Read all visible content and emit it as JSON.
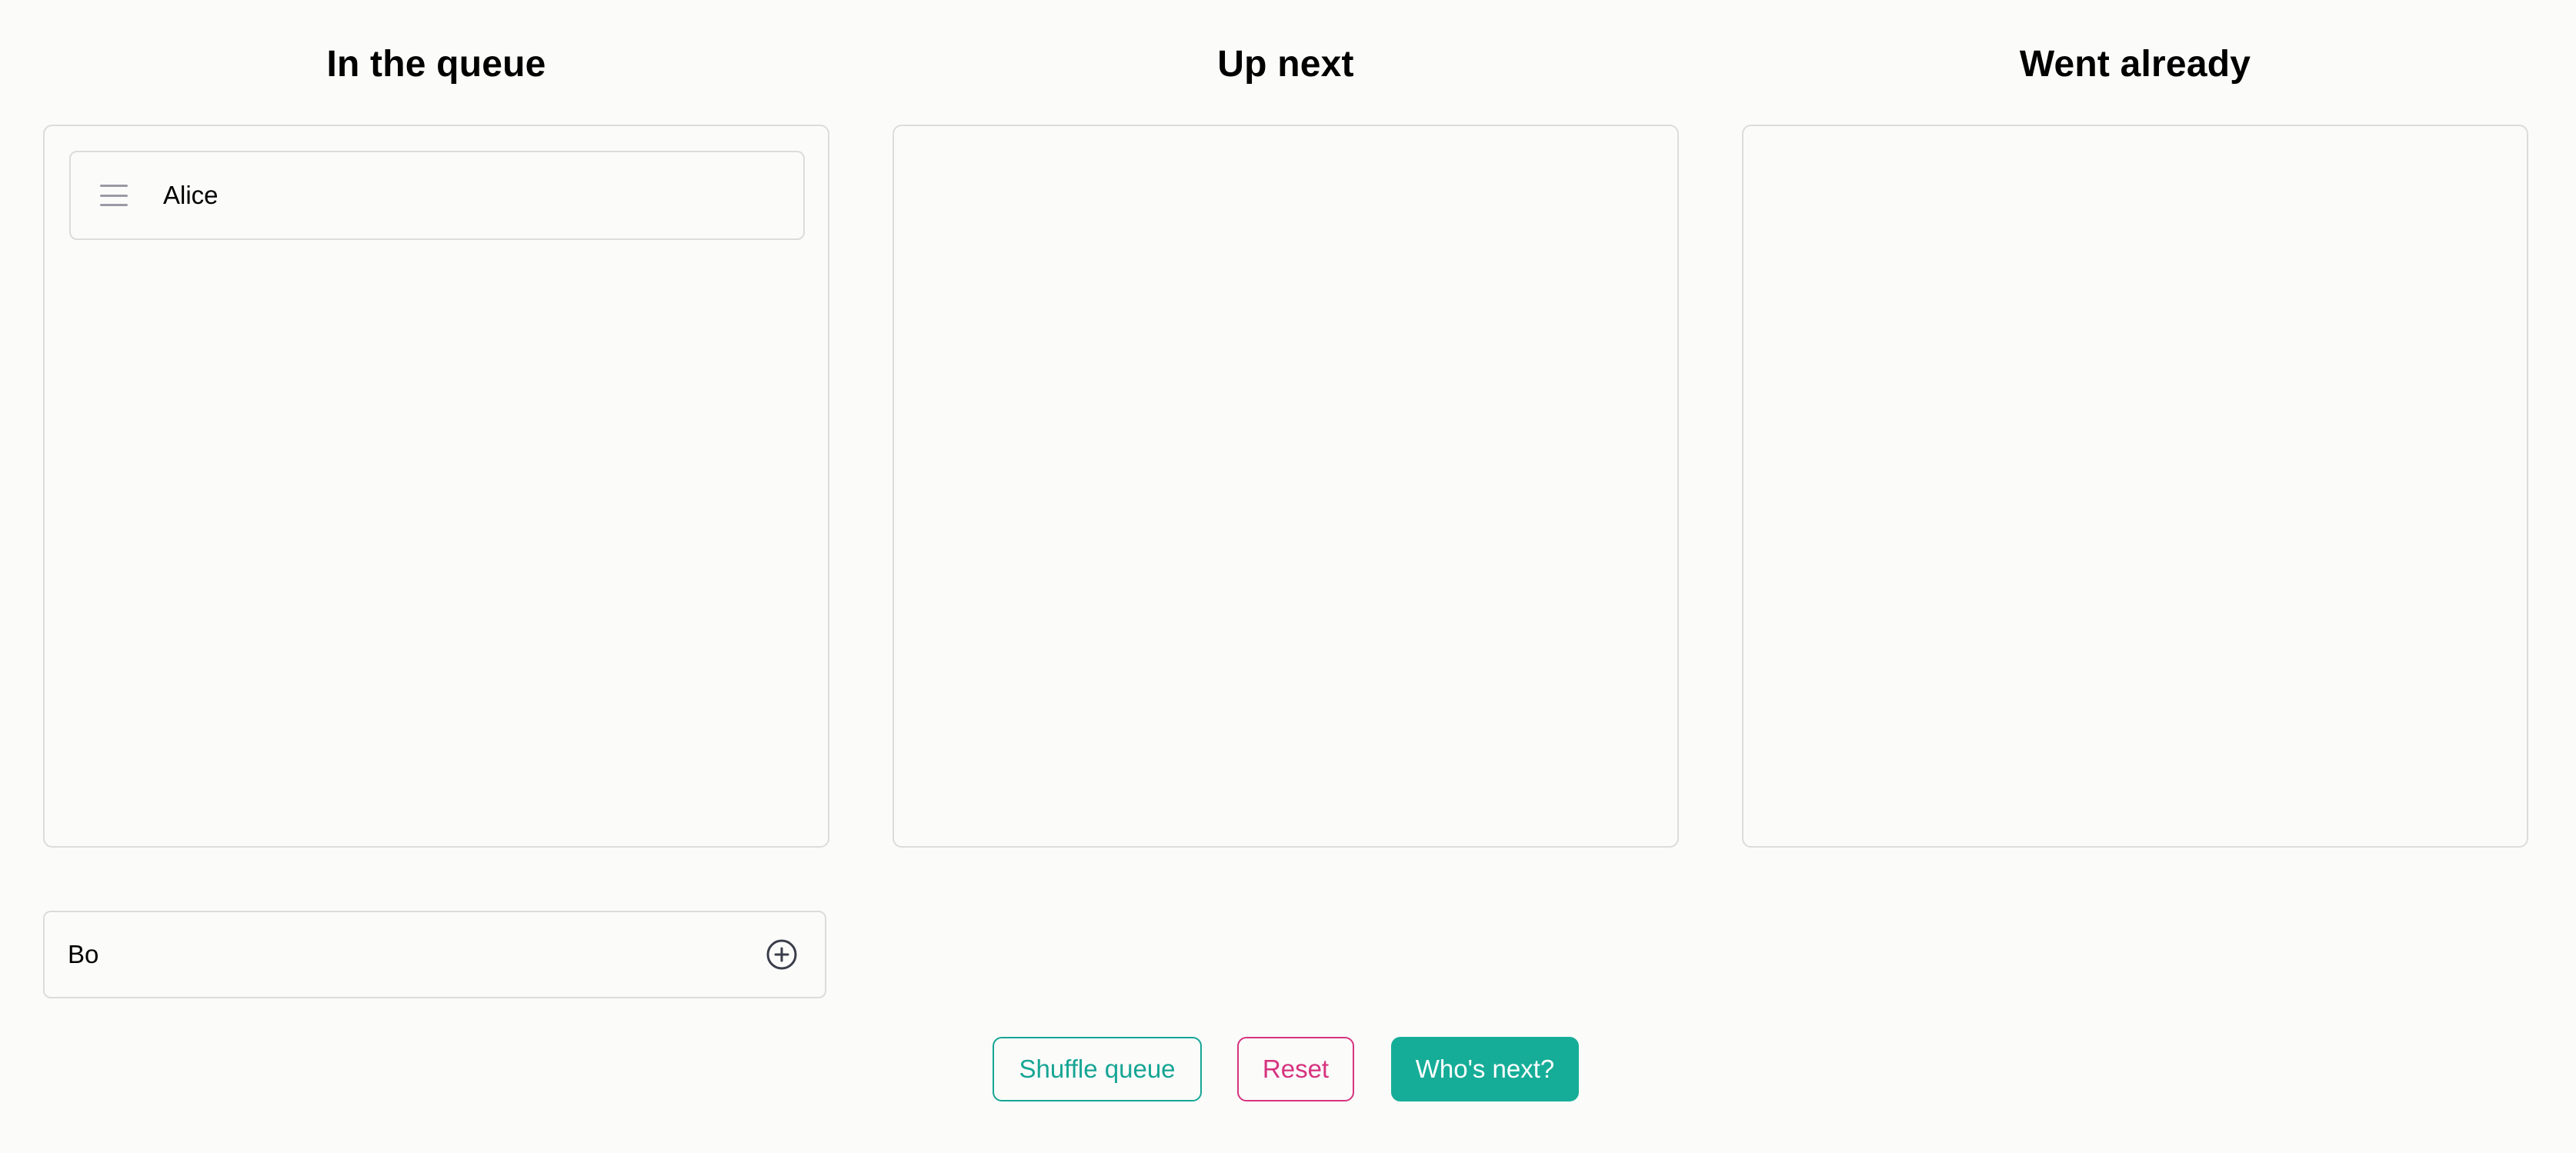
{
  "columns": [
    {
      "title": "In the queue"
    },
    {
      "title": "Up next"
    },
    {
      "title": "Went already"
    }
  ],
  "queue": {
    "items": [
      {
        "name": "Alice"
      }
    ]
  },
  "add_person": {
    "value": "Bo",
    "icon": "plus-circle-icon"
  },
  "actions": {
    "shuffle_label": "Shuffle queue",
    "reset_label": "Reset",
    "next_label": "Who's next?"
  },
  "colors": {
    "teal": "#16a594",
    "pink": "#d6337e",
    "border": "#dcdcdc",
    "background": "#fbfbfa"
  }
}
